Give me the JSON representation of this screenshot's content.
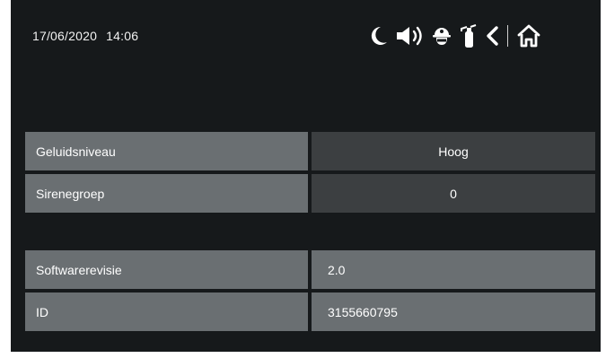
{
  "header": {
    "date": "17/06/2020",
    "time": "14:06",
    "icons": [
      "moon-icon",
      "speaker-icon",
      "firefighter-helmet-icon",
      "fire-extinguisher-icon",
      "back-chevron-icon",
      "home-icon"
    ]
  },
  "settings": [
    {
      "label": "Geluidsniveau",
      "value": "Hoog"
    },
    {
      "label": "Sirenegroep",
      "value": "0"
    }
  ],
  "info": [
    {
      "label": "Softwarerevisie",
      "value": "2.0"
    },
    {
      "label": "ID",
      "value": "3155660795"
    }
  ],
  "colors": {
    "background": "#16191b",
    "label_cell": "#6a6f72",
    "value_cell": "#3c3f41",
    "text": "#ffffff"
  }
}
